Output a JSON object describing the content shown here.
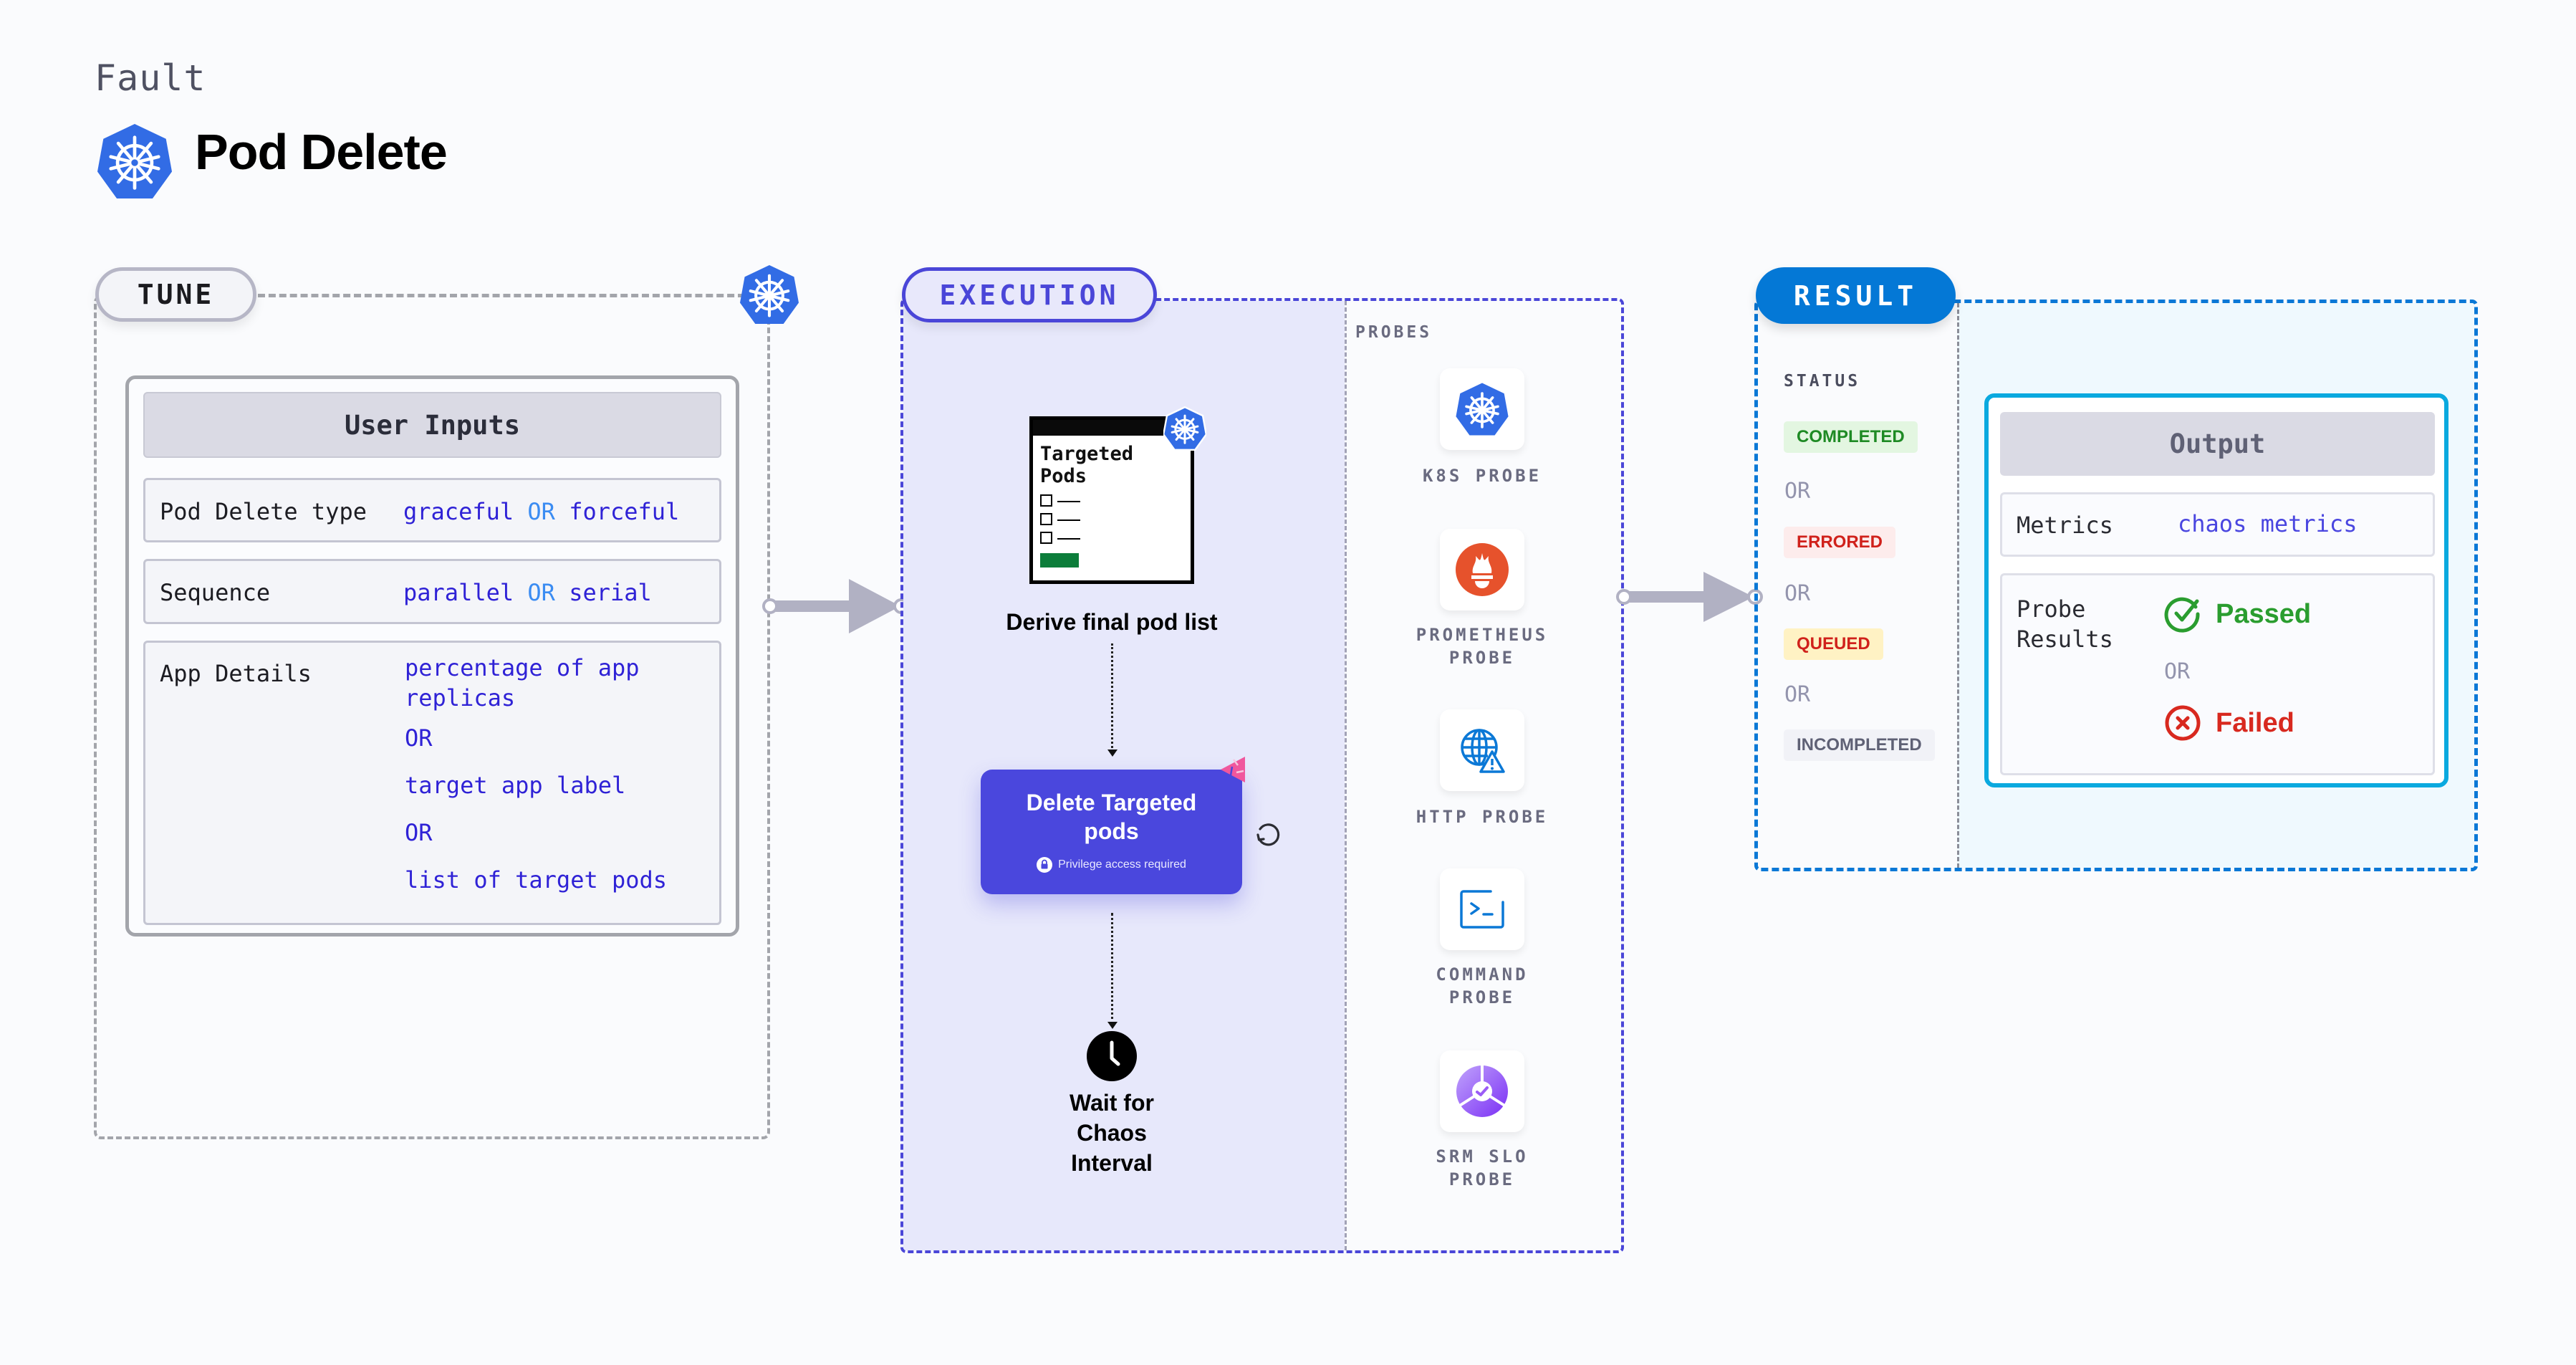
{
  "header": {
    "fault_label": "Fault",
    "title": "Pod Delete",
    "logo_icon": "kubernetes-icon"
  },
  "colors": {
    "kubernetes_blue": "#326ce5",
    "execution_accent": "#4a46d8",
    "result_accent": "#0478d6",
    "value_text": "#2f22d6",
    "or_text": "#3b8cf2",
    "passed": "#2a9d2f",
    "failed": "#d8291f"
  },
  "tune": {
    "pill_label": "TUNE",
    "user_inputs": {
      "header": "User Inputs",
      "rows": [
        {
          "label": "Pod Delete type",
          "values": [
            "graceful",
            "forceful"
          ],
          "separator": "OR"
        },
        {
          "label": "Sequence",
          "values": [
            "parallel",
            "serial"
          ],
          "separator": "OR"
        }
      ],
      "app_details": {
        "label": "App Details",
        "options": [
          "percentage of app replicas",
          "target app label",
          "list of target pods"
        ],
        "separator": "OR"
      }
    }
  },
  "execution": {
    "pill_label": "EXECUTION",
    "pod_list_card": {
      "title_line1": "Targeted",
      "title_line2": "Pods"
    },
    "steps": [
      {
        "label": "Derive final pod list",
        "icon": "pod-list-icon"
      },
      {
        "label": "Delete Targeted pods",
        "note": "Privilege access required",
        "icon": "chaos-badge-icon"
      },
      {
        "label": "Wait for Chaos Interval",
        "icon": "clock-icon"
      }
    ],
    "probes": {
      "label": "PROBES",
      "items": [
        {
          "label": "K8S PROBE",
          "icon": "kubernetes-icon"
        },
        {
          "label": "PROMETHEUS PROBE",
          "icon": "prometheus-icon"
        },
        {
          "label": "HTTP PROBE",
          "icon": "globe-warning-icon"
        },
        {
          "label": "COMMAND PROBE",
          "icon": "terminal-icon"
        },
        {
          "label": "SRM SLO PROBE",
          "icon": "slo-icon"
        }
      ]
    }
  },
  "result": {
    "pill_label": "RESULT",
    "status_label": "STATUS",
    "or_label": "OR",
    "statuses": [
      {
        "label": "COMPLETED",
        "bg": "#e3f6e1",
        "fg": "#1e8a24"
      },
      {
        "label": "ERRORED",
        "bg": "#fdecec",
        "fg": "#d0211b"
      },
      {
        "label": "QUEUED",
        "bg": "#fff2c4",
        "fg": "#d0211b"
      },
      {
        "label": "INCOMPLETED",
        "bg": "#f1f2f7",
        "fg": "#5f6175"
      }
    ],
    "output": {
      "header": "Output",
      "metrics_label": "Metrics",
      "metrics_value": "chaos metrics",
      "probe_results_label_line1": "Probe",
      "probe_results_label_line2": "Results",
      "passed": "Passed",
      "or": "OR",
      "failed": "Failed"
    }
  }
}
